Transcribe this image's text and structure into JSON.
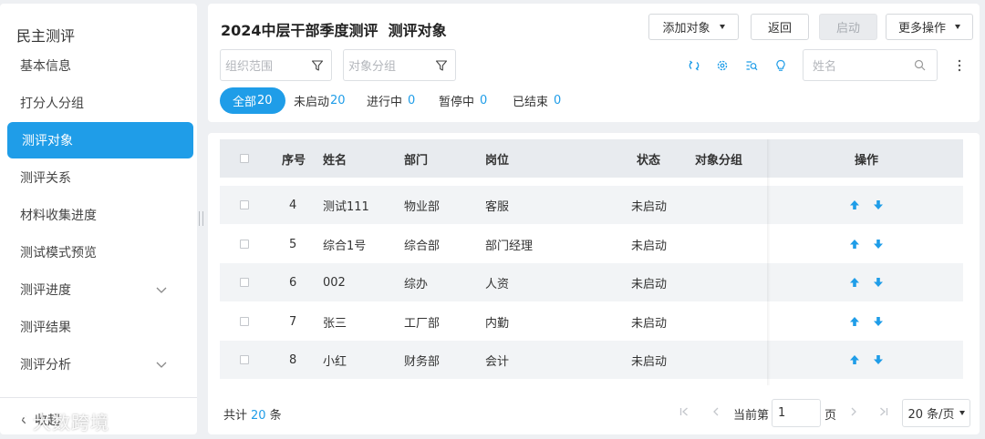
{
  "sidebar": {
    "title": "民主测评",
    "items": [
      {
        "label": "基本信息",
        "active": false
      },
      {
        "label": "打分人分组",
        "active": false
      },
      {
        "label": "测评对象",
        "active": true
      },
      {
        "label": "测评关系",
        "active": false
      },
      {
        "label": "材料收集进度",
        "active": false
      },
      {
        "label": "测试模式预览",
        "active": false
      },
      {
        "label": "测评进度",
        "active": false,
        "expandable": true
      },
      {
        "label": "测评结果",
        "active": false
      },
      {
        "label": "测评分析",
        "active": false,
        "expandable": true
      }
    ],
    "collapse_label": "收起"
  },
  "watermark": "大数跨境",
  "header": {
    "title": "2024中层干部季度测评  测评对象",
    "buttons": {
      "add": "添加对象",
      "back": "返回",
      "start": "启动",
      "more": "更多操作"
    },
    "filters": {
      "org_placeholder": "组织范围",
      "group_placeholder": "对象分组"
    },
    "search_placeholder": "姓名",
    "status_tabs": [
      {
        "label": "全部",
        "count": "20",
        "active": true
      },
      {
        "label": "未启动",
        "count": "20",
        "active": false
      },
      {
        "label": "进行中",
        "count": "0",
        "active": false
      },
      {
        "label": "暂停中",
        "count": "0",
        "active": false
      },
      {
        "label": "已结束",
        "count": "0",
        "active": false
      }
    ]
  },
  "table": {
    "columns": [
      "序号",
      "姓名",
      "部门",
      "岗位",
      "状态",
      "对象分组",
      "操作"
    ],
    "rows": [
      {
        "no": "4",
        "name": "测试111",
        "dept": "物业部",
        "post": "客服",
        "status": "未启动",
        "group": ""
      },
      {
        "no": "5",
        "name": "综合1号",
        "dept": "综合部",
        "post": "部门经理",
        "status": "未启动",
        "group": ""
      },
      {
        "no": "6",
        "name": "002",
        "dept": "综办",
        "post": "人资",
        "status": "未启动",
        "group": ""
      },
      {
        "no": "7",
        "name": "张三",
        "dept": "工厂部",
        "post": "内勤",
        "status": "未启动",
        "group": ""
      },
      {
        "no": "8",
        "name": "小红",
        "dept": "财务部",
        "post": "会计",
        "status": "未启动",
        "group": ""
      }
    ]
  },
  "pagination": {
    "total_prefix": "共计",
    "total": "20",
    "total_suffix": "条",
    "current_label": "当前第",
    "current_page": "1",
    "page_label": "页",
    "page_size": "20 条/页"
  },
  "colors": {
    "accent": "#1f9de8",
    "panel_bg": "#ffffff",
    "page_bg": "#eef0f3",
    "header_row_bg": "#e8ebef"
  }
}
